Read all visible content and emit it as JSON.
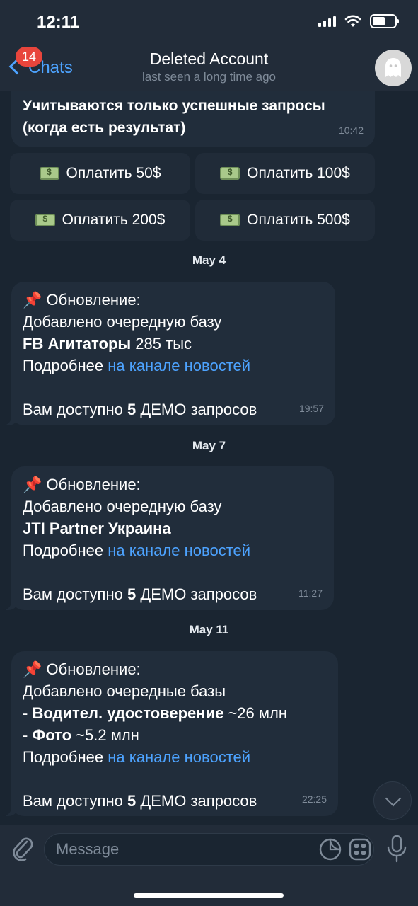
{
  "status": {
    "time": "12:11",
    "battery_level": 0.55
  },
  "nav": {
    "back_label": "Chats",
    "unread_count": "14",
    "title": "Deleted Account",
    "subtitle": "last seen a long time ago",
    "avatar_icon": "ghost-icon"
  },
  "first_message": {
    "lines": [
      "Учитываются только успешные запросы",
      "(когда есть результат)"
    ],
    "time": "10:42"
  },
  "pay_buttons": [
    {
      "label": "Оплатить 50$",
      "icon": "money-icon"
    },
    {
      "label": "Оплатить 100$",
      "icon": "money-icon"
    },
    {
      "label": "Оплатить 200$",
      "icon": "money-icon"
    },
    {
      "label": "Оплатить 500$",
      "icon": "money-icon"
    }
  ],
  "messages": [
    {
      "date": "May 4",
      "header": "Обновление:",
      "added": "Добавлено очередную базу",
      "base_bold": "FB Агитаторы",
      "base_rest": " 285 тыс",
      "more_prefix": "Подробнее ",
      "more_link": "на канале новостей",
      "demo_prefix": "Вам доступно ",
      "demo_count": "5",
      "demo_suffix": " ДЕМО запросов",
      "time": "19:57"
    },
    {
      "date": "May 7",
      "header": "Обновление:",
      "added": "Добавлено очередную базу",
      "base_bold": "JTI Partner Украина",
      "more_prefix": "Подробнее ",
      "more_link": "на канале новостей",
      "demo_prefix": "Вам доступно ",
      "demo_count": "5",
      "demo_suffix": " ДЕМО запросов",
      "time": "11:27"
    },
    {
      "date": "May 11",
      "header": "Обновление:",
      "added": "Добавлено очередные базы",
      "item1_prefix": "- ",
      "item1_bold": "Водител. удостоверение",
      "item1_rest": " ~26 млн",
      "item2_prefix": "- ",
      "item2_bold": "Фото",
      "item2_rest": " ~5.2 млн",
      "more_prefix": "Подробнее ",
      "more_link": "на канале новостей",
      "demo_prefix": "Вам доступно ",
      "demo_count": "5",
      "demo_suffix": " ДЕМО запросов",
      "time": "22:25"
    }
  ],
  "input": {
    "placeholder": "Message"
  },
  "colors": {
    "accent": "#4da3ff",
    "badge": "#e8453c",
    "background": "#1a2531",
    "bubble": "#212d3b"
  }
}
